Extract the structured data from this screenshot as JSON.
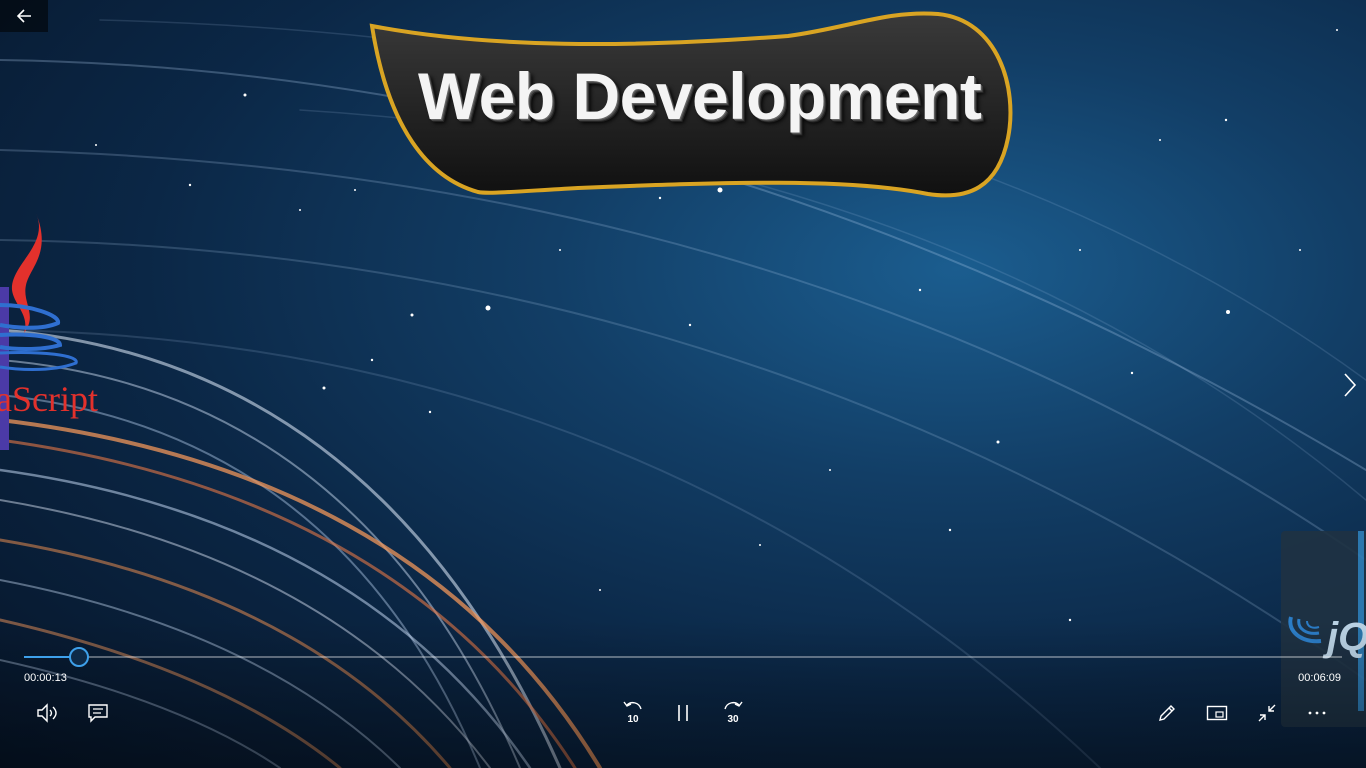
{
  "window": {
    "back_icon": "arrow-left-icon",
    "next_icon": "chevron-right-icon"
  },
  "video": {
    "title": "Web Development",
    "left_logo_text": "aScript",
    "thumbnail_text": "jQ",
    "progress_fraction": 0.042
  },
  "playback": {
    "current_time": "00:00:13",
    "total_time": "00:06:09",
    "skip_back_seconds": "10",
    "skip_forward_seconds": "30"
  },
  "toolbar": {
    "volume_icon": "volume-icon",
    "captions_icon": "captions-icon",
    "pause_icon": "pause-icon",
    "edit_icon": "pencil-icon",
    "miniview_icon": "mini-view-icon",
    "exit_fullscreen_icon": "exit-fullscreen-icon",
    "more_icon": "more-options-icon"
  },
  "colors": {
    "accent": "#3ea0ea",
    "banner_border": "#d9a423",
    "logo_red": "#e3312c"
  }
}
